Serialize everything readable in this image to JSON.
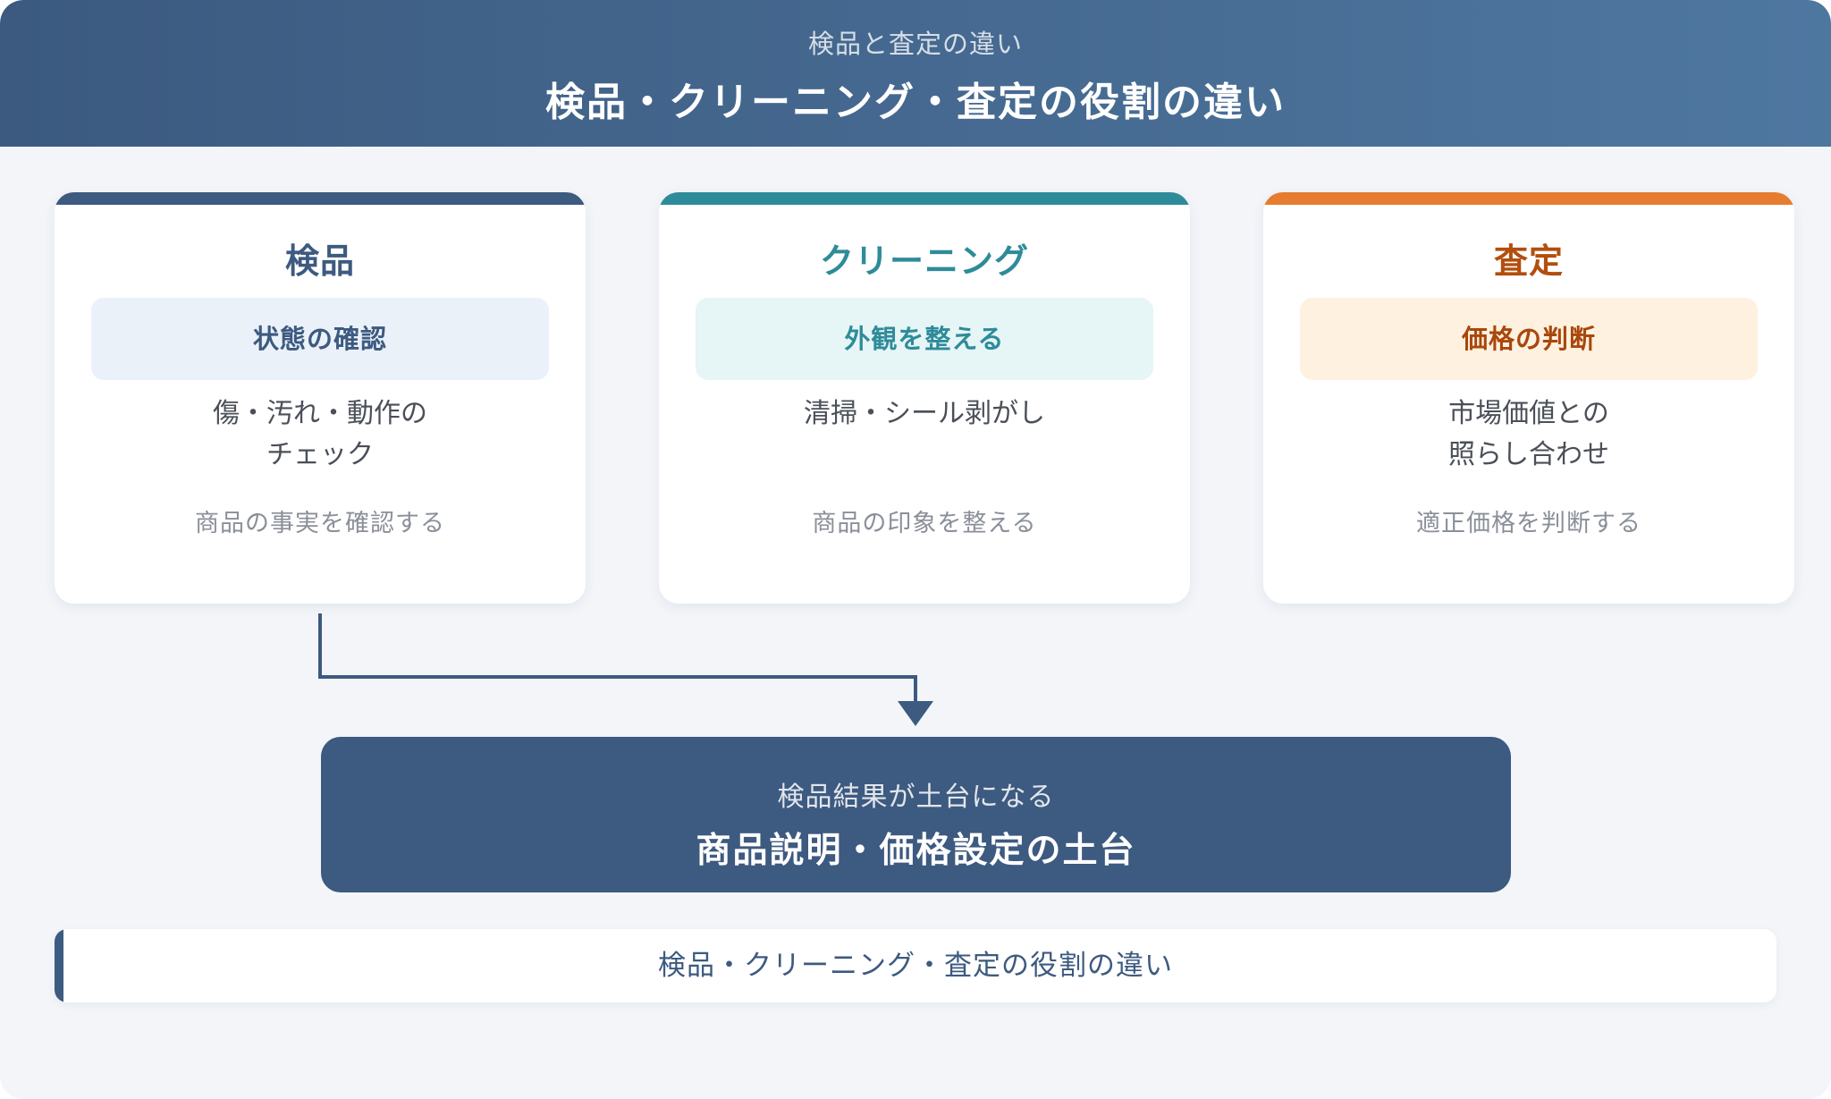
{
  "header": {
    "subtitle": "検品と査定の違い",
    "title": "検品・クリーニング・査定の役割の違い"
  },
  "colors": {
    "header_gradient_start": "#3c5a80",
    "header_gradient_end": "#4e77a0",
    "inspection_accent": "#3d5a80",
    "cleaning_accent": "#2e8b9a",
    "appraisal_accent": "#e57c30"
  },
  "cards": [
    {
      "title": "検品",
      "pill": "状態の確認",
      "description": "傷・汚れ・動作の\nチェック",
      "note": "商品の事実を確認する",
      "accent": "#3d5a80",
      "title_color": "#3d5a80",
      "pill_bg": "#eaf1f9",
      "pill_color": "#3d5a80"
    },
    {
      "title": "クリーニング",
      "pill": "外観を整える",
      "description": "清掃・シール剥がし",
      "note": "商品の印象を整える",
      "accent": "#2e8b9a",
      "title_color": "#2e8b9a",
      "pill_bg": "#e6f5f5",
      "pill_color": "#2e8b9a"
    },
    {
      "title": "査定",
      "pill": "価格の判断",
      "description": "市場価値との\n照らし合わせ",
      "note": "適正価格を判断する",
      "accent": "#e57c30",
      "title_color": "#b34e0e",
      "pill_bg": "#fef1e0",
      "pill_color": "#a9470c"
    }
  ],
  "result": {
    "subtitle": "検品結果が土台になる",
    "title": "商品説明・価格設定の土台"
  },
  "footer": {
    "text": "検品・クリーニング・査定の役割の違い"
  }
}
